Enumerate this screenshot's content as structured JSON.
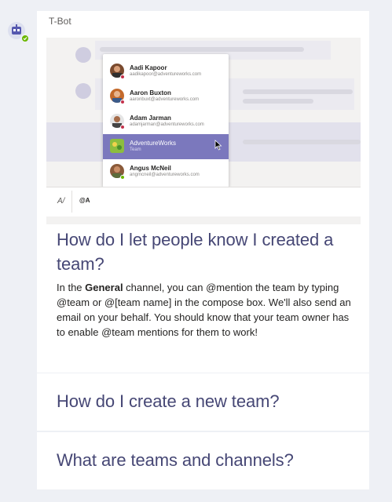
{
  "bot": {
    "name": "T-Bot",
    "status_color": "#6bb700",
    "avatar_icon": "bot-icon"
  },
  "preview": {
    "people": [
      {
        "name": "Aadi Kapoor",
        "email": "aadikapoor@adventureworks.com",
        "status": "busy",
        "status_color": "#c4314b",
        "avatar_color": "#7a4a2e",
        "active": false
      },
      {
        "name": "Aaron Buxton",
        "email": "aaronbuxt@adventureworks.com",
        "status": "busy",
        "status_color": "#c4314b",
        "avatar_color": "#c46a2b",
        "active": false
      },
      {
        "name": "Adam Jarman",
        "email": "adamjarman@adventureworks.com",
        "status": "busy",
        "status_color": "#c4314b",
        "avatar_color": "#a56b49",
        "active": false
      },
      {
        "name": "AdventureWorks",
        "email": "Team",
        "status": "none",
        "status_color": "#7b78bd",
        "avatar_color": "#8cbd3f",
        "active": true
      },
      {
        "name": "Angus McNeil",
        "email": "angmcneil@adventureworks.com",
        "status": "available",
        "status_color": "#6bb700",
        "avatar_color": "#8a5a3a",
        "active": false
      }
    ],
    "compose_text": "@A",
    "format_icon": "format-icon"
  },
  "faq": [
    {
      "question": "How do I let people know I created a team?",
      "answer_prefix": "In the ",
      "answer_bold": "General",
      "answer_suffix": " channel, you can @mention the team by typing @team or @[team name] in the compose box. We'll also send an email on your behalf. You should know that your team owner has to enable @team mentions for them to work!"
    },
    {
      "question": "How do I create a new team?"
    },
    {
      "question": "What are teams and channels?"
    }
  ],
  "colors": {
    "accent": "#464775",
    "highlight": "#7b78bd",
    "background": "#eef0f5"
  }
}
